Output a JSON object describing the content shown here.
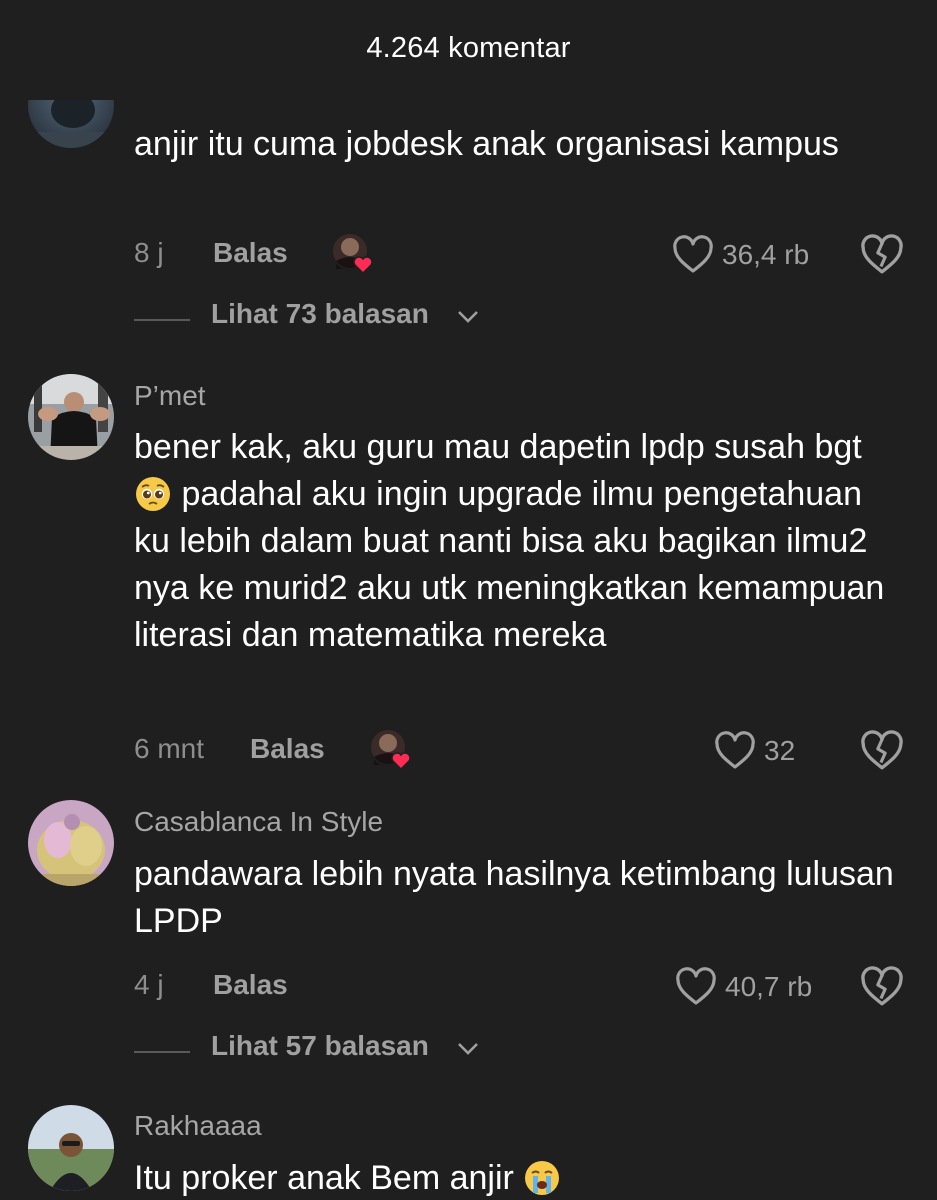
{
  "header": {
    "title": "4.264 komentar"
  },
  "comments": [
    {
      "username": "",
      "text": "anjir itu cuma jobdesk anak organisasi kampus",
      "time": "8 j",
      "reply_label": "Balas",
      "likes": "36,4 rb",
      "view_replies": "Lihat 73 balasan"
    },
    {
      "username": "P’met",
      "text": "bener kak, aku guru mau dapetin lpdp susah bgt",
      "text_after_emoji": " padahal aku ingin upgrade ilmu pengetahuan ku lebih dalam buat nanti bisa aku bagikan ilmu2 nya ke murid2 aku utk meningkatkan kemampuan literasi dan matematika mereka",
      "emoji": "pleading-face",
      "time": "6 mnt",
      "reply_label": "Balas",
      "likes": "32"
    },
    {
      "username": "Casablanca In Style",
      "text": "pandawara lebih nyata hasilnya ketimbang lulusan LPDP",
      "time": "4 j",
      "reply_label": "Balas",
      "likes": "40,7 rb",
      "view_replies": "Lihat 57 balasan"
    },
    {
      "username": "Rakhaaaa",
      "text": "Itu proker anak Bem anjir",
      "emoji": "loudly-crying-face"
    }
  ],
  "icons": {
    "like": "heart-outline-icon",
    "dislike": "broken-heart-icon",
    "expand": "chevron-down-icon",
    "creator_liked": "creator-liked-avatar"
  },
  "colors": {
    "background": "#1f1f1f",
    "text": "#ffffff",
    "secondary": "#a0a0a0",
    "heart_red": "#fe2c55"
  }
}
